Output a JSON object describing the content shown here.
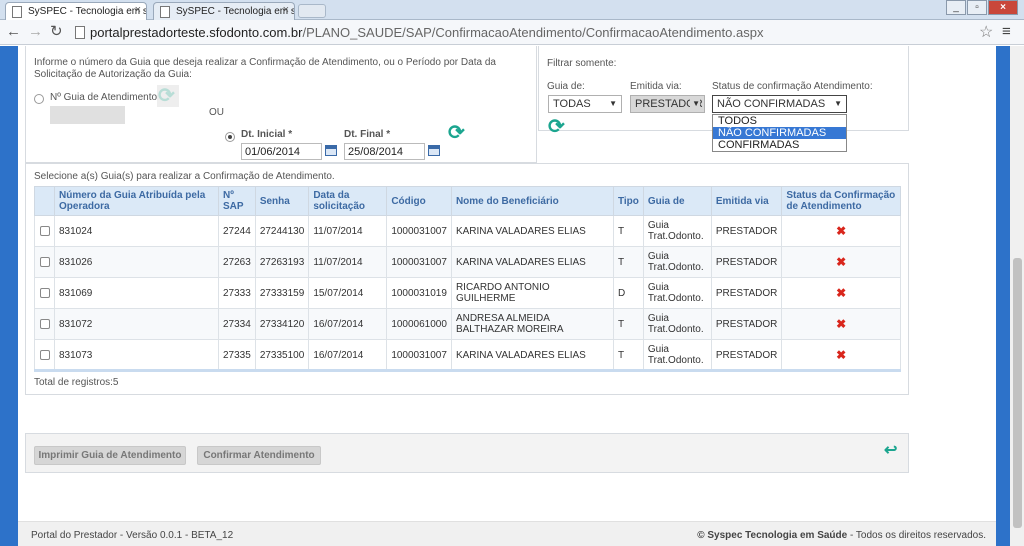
{
  "browser": {
    "tabs": [
      {
        "label": "SySPEC - Tecnologia em s"
      },
      {
        "label": "SySPEC - Tecnologia em s"
      }
    ],
    "url_host": "portalprestadorteste.sfodonto.com.br",
    "url_path": "/PLANO_SAUDE/SAP/ConfirmacaoAtendimento/ConfirmacaoAtendimento.aspx"
  },
  "search": {
    "instructions": "Informe o número da Guia que deseja realizar a Confirmação de Atendimento, ou o Período por Data da Solicitação de Autorização da Guia:",
    "guia_radio_label": "Nº Guia de Atendimento",
    "or_label": "OU",
    "dt_inicial_label": "Dt. Inicial *",
    "dt_inicial_value": "01/06/2014",
    "dt_final_label": "Dt. Final *",
    "dt_final_value": "25/08/2014"
  },
  "filter": {
    "title": "Filtrar somente:",
    "guia_de_label": "Guia de:",
    "guia_de_value": "TODAS",
    "emitida_via_label": "Emitida via:",
    "emitida_via_value": "PRESTADOR",
    "status_label": "Status de confirmação Atendimento:",
    "status_value": "NÃO CONFIRMADAS",
    "status_options": [
      "TODOS",
      "NÃO CONFIRMADAS",
      "CONFIRMADAS"
    ]
  },
  "results": {
    "title": "Selecione a(s) Guia(s) para realizar a Confirmação de Atendimento.",
    "columns": [
      "Número da Guia Atribuída pela Operadora",
      "Nº SAP",
      "Senha",
      "Data da solicitação",
      "Código",
      "Nome do Beneficiário",
      "Tipo",
      "Guia de",
      "Emitida via",
      "Status da Confirmação de Atendimento"
    ],
    "rows": [
      {
        "guia": "831024",
        "sap": "27244",
        "senha": "27244130",
        "data": "11/07/2014",
        "codigo": "1000031007",
        "nome": "KARINA VALADARES ELIAS",
        "tipo": "T",
        "guia_de": "Guia Trat.Odonto.",
        "emitida": "PRESTADOR"
      },
      {
        "guia": "831026",
        "sap": "27263",
        "senha": "27263193",
        "data": "11/07/2014",
        "codigo": "1000031007",
        "nome": "KARINA VALADARES ELIAS",
        "tipo": "T",
        "guia_de": "Guia Trat.Odonto.",
        "emitida": "PRESTADOR"
      },
      {
        "guia": "831069",
        "sap": "27333",
        "senha": "27333159",
        "data": "15/07/2014",
        "codigo": "1000031019",
        "nome": "RICARDO ANTONIO GUILHERME",
        "tipo": "D",
        "guia_de": "Guia Trat.Odonto.",
        "emitida": "PRESTADOR"
      },
      {
        "guia": "831072",
        "sap": "27334",
        "senha": "27334120",
        "data": "16/07/2014",
        "codigo": "1000061000",
        "nome": "ANDRESA ALMEIDA BALTHAZAR MOREIRA",
        "tipo": "T",
        "guia_de": "Guia Trat.Odonto.",
        "emitida": "PRESTADOR"
      },
      {
        "guia": "831073",
        "sap": "27335",
        "senha": "27335100",
        "data": "16/07/2014",
        "codigo": "1000031007",
        "nome": "KARINA VALADARES ELIAS",
        "tipo": "T",
        "guia_de": "Guia Trat.Odonto.",
        "emitida": "PRESTADOR"
      }
    ],
    "total_label": "Total de registros:5"
  },
  "actions": {
    "print_label": "Imprimir Guia de Atendimento",
    "confirm_label": "Confirmar Atendimento"
  },
  "footer": {
    "version": "Portal do Prestador - Versão 0.0.1 - BETA_12",
    "company": "© Syspec Tecnologia em Saúde",
    "rights": " - Todos os direitos reservados."
  },
  "colors": {
    "accent": "#2d72c9",
    "header_bg": "#dbe9f7",
    "status_x": "#d9261c",
    "refresh": "#1ba58f"
  }
}
